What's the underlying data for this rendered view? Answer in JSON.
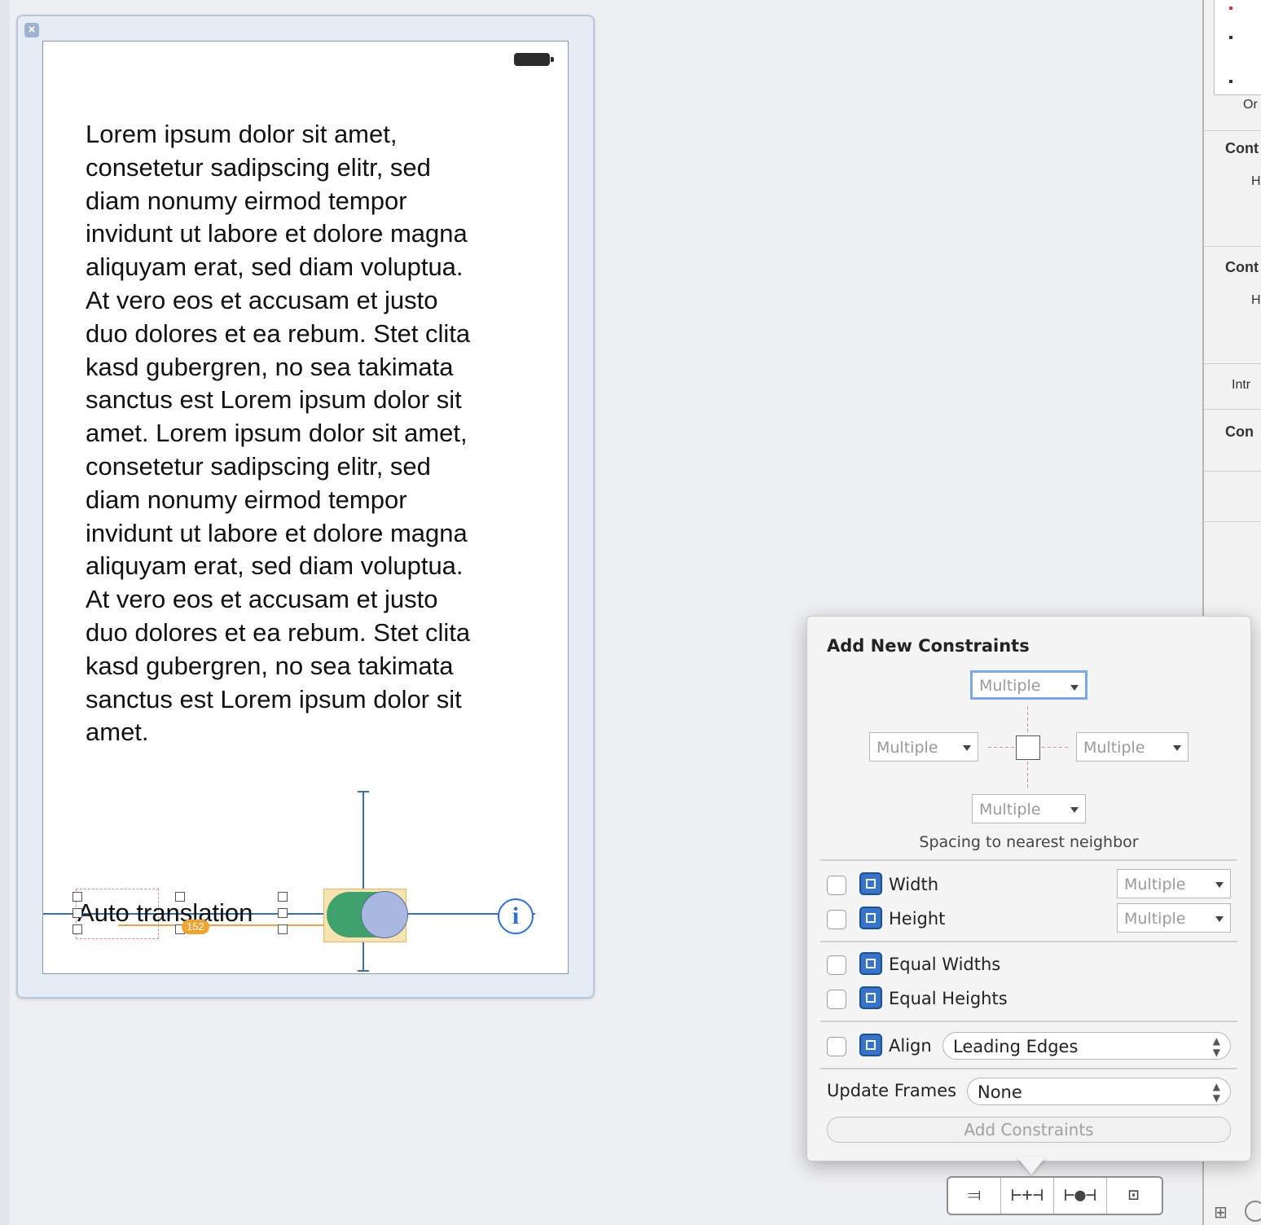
{
  "scene": {
    "close_glyph": "×",
    "body_text": "Lorem ipsum dolor sit amet,\nconsetetur sadipscing elitr, sed\ndiam nonumy eirmod tempor\ninvidunt ut labore et dolore magna\naliquyam erat, sed diam voluptua.\nAt vero eos et accusam et justo\nduo dolores et ea rebum. Stet clita\nkasd gubergren, no sea takimata\nsanctus est Lorem ipsum dolor sit\namet. Lorem ipsum dolor sit amet,\nconsetetur sadipscing elitr, sed\ndiam nonumy eirmod tempor\ninvidunt ut labore et dolore magna\naliquyam erat, sed diam voluptua.\nAt vero eos et accusam et justo\nduo dolores et ea rebum. Stet clita\nkasd gubergren, no sea takimata\nsanctus est Lorem ipsum dolor sit\namet.",
    "label_text": "Auto translation",
    "badge_text": "152",
    "info_glyph": "i",
    "switch_on": true
  },
  "popover": {
    "title": "Add New Constraints",
    "spacing": {
      "top": "Multiple",
      "left": "Multiple",
      "right": "Multiple",
      "bottom": "Multiple",
      "caption": "Spacing to nearest neighbor"
    },
    "width": {
      "label": "Width",
      "value": "Multiple",
      "checked": false
    },
    "height": {
      "label": "Height",
      "value": "Multiple",
      "checked": false
    },
    "equal_widths": {
      "label": "Equal Widths",
      "checked": false
    },
    "equal_heights": {
      "label": "Equal Heights",
      "checked": false
    },
    "align": {
      "label": "Align",
      "value": "Leading Edges",
      "checked": false
    },
    "update_frames": {
      "label": "Update Frames",
      "value": "None"
    },
    "add_button": "Add Constraints"
  },
  "toolbar": {
    "buttons": [
      {
        "icon": "align-icon",
        "glyph": "⫤"
      },
      {
        "icon": "pin-icon",
        "glyph": "⊢+⊣"
      },
      {
        "icon": "resolve-icon",
        "glyph": "⊢●⊣"
      },
      {
        "icon": "resizing-icon",
        "glyph": "⊡"
      }
    ]
  },
  "inspector": {
    "labels": [
      "Or",
      "Cont",
      "H",
      "Cont",
      "H",
      "Intr",
      "Con"
    ]
  },
  "colors": {
    "accent": "#3674c9",
    "switch_green": "#3fa16b",
    "badge_orange": "#f0a42f",
    "constraint_blue": "#3d6fb0"
  }
}
